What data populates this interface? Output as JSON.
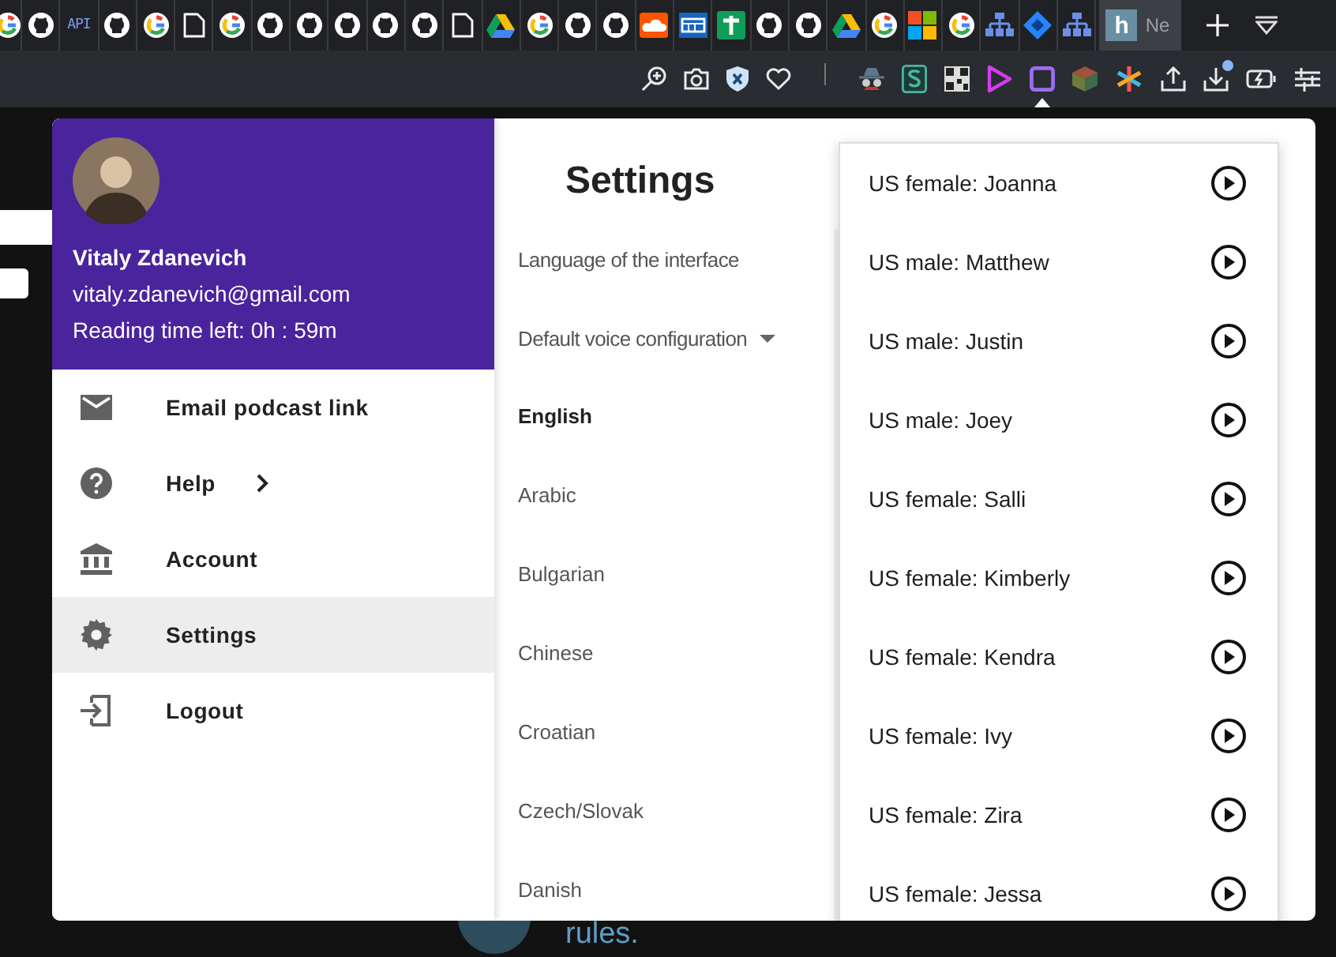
{
  "browser": {
    "tabs": [
      {
        "kind": "google",
        "selected": false
      },
      {
        "kind": "github",
        "selected": false
      },
      {
        "kind": "api",
        "icon_text": "API",
        "selected": false
      },
      {
        "kind": "github",
        "selected": false
      },
      {
        "kind": "google",
        "selected": false
      },
      {
        "kind": "document",
        "selected": false
      },
      {
        "kind": "google",
        "selected": false
      },
      {
        "kind": "github",
        "selected": false
      },
      {
        "kind": "github",
        "selected": false
      },
      {
        "kind": "github",
        "selected": false
      },
      {
        "kind": "github",
        "selected": false
      },
      {
        "kind": "github",
        "selected": false
      },
      {
        "kind": "document",
        "selected": false
      },
      {
        "kind": "drive",
        "selected": false
      },
      {
        "kind": "google",
        "selected": false
      },
      {
        "kind": "github",
        "selected": false
      },
      {
        "kind": "github",
        "selected": false
      },
      {
        "kind": "cloud",
        "selected": false
      },
      {
        "kind": "grid",
        "selected": false
      },
      {
        "kind": "plus",
        "selected": false
      },
      {
        "kind": "github",
        "selected": false
      },
      {
        "kind": "github",
        "selected": false
      },
      {
        "kind": "drive",
        "selected": false
      },
      {
        "kind": "google",
        "selected": false
      },
      {
        "kind": "windows",
        "selected": false
      },
      {
        "kind": "google",
        "selected": false
      },
      {
        "kind": "sitemap",
        "selected": false
      },
      {
        "kind": "diamond",
        "selected": false
      },
      {
        "kind": "sitemap",
        "selected": false
      },
      {
        "kind": "letter",
        "icon_text": "h",
        "title": "Ne",
        "selected": true
      }
    ]
  },
  "toolbar": {
    "icons": [
      {
        "kind": "zoom",
        "selected": false,
        "notification": false
      },
      {
        "kind": "camera",
        "selected": false,
        "notification": false
      },
      {
        "kind": "shield",
        "selected": false,
        "notification": false
      },
      {
        "kind": "heart",
        "selected": false,
        "notification": false
      },
      {
        "kind": "separator"
      },
      {
        "kind": "spy",
        "selected": false,
        "notification": false
      },
      {
        "kind": "s-badge",
        "selected": false,
        "notification": false
      },
      {
        "kind": "qr",
        "selected": false,
        "notification": false
      },
      {
        "kind": "play",
        "selected": false,
        "notification": false
      },
      {
        "kind": "square",
        "selected": true,
        "notification": false
      },
      {
        "kind": "cube",
        "selected": false,
        "notification": false
      },
      {
        "kind": "asterisk",
        "selected": false,
        "notification": false
      },
      {
        "kind": "share",
        "selected": false,
        "notification": false
      },
      {
        "kind": "download",
        "selected": false,
        "notification": true
      },
      {
        "kind": "battery",
        "selected": false,
        "notification": false
      },
      {
        "kind": "sliders",
        "selected": false,
        "notification": false
      }
    ]
  },
  "page": {
    "text": "rules."
  },
  "popup": {
    "profile": {
      "name": "Vitaly Zdanevich",
      "email": "vitaly.zdanevich@gmail.com",
      "reading_time": "Reading time left: 0h : 59m"
    },
    "menu": [
      {
        "label": "Email podcast link",
        "kind": "mail",
        "has_submenu": false,
        "selected": false
      },
      {
        "label": "Help",
        "kind": "help",
        "has_submenu": true,
        "selected": false
      },
      {
        "label": "Account",
        "kind": "bank",
        "has_submenu": false,
        "selected": false
      },
      {
        "label": "Settings",
        "kind": "gear",
        "has_submenu": false,
        "selected": true
      },
      {
        "label": "Logout",
        "kind": "logout",
        "has_submenu": false,
        "selected": false
      }
    ],
    "settings": {
      "title": "Settings",
      "fields": [
        {
          "label": "Language of the interface",
          "kind": "text"
        },
        {
          "label": "Default voice configuration",
          "kind": "dropdown"
        }
      ],
      "languages": [
        {
          "label": "English",
          "selected": true
        },
        {
          "label": "Arabic",
          "selected": false
        },
        {
          "label": "Bulgarian",
          "selected": false
        },
        {
          "label": "Chinese",
          "selected": false
        },
        {
          "label": "Croatian",
          "selected": false
        },
        {
          "label": "Czech/Slovak",
          "selected": false
        },
        {
          "label": "Danish",
          "selected": false
        }
      ]
    },
    "voices": [
      {
        "label": "US female: Joanna"
      },
      {
        "label": "US male: Matthew"
      },
      {
        "label": "US male: Justin"
      },
      {
        "label": "US male: Joey"
      },
      {
        "label": "US female: Salli"
      },
      {
        "label": "US female: Kimberly"
      },
      {
        "label": "US female: Kendra"
      },
      {
        "label": "US female: Ivy"
      },
      {
        "label": "US female: Zira"
      },
      {
        "label": "US female: Jessa"
      }
    ]
  }
}
